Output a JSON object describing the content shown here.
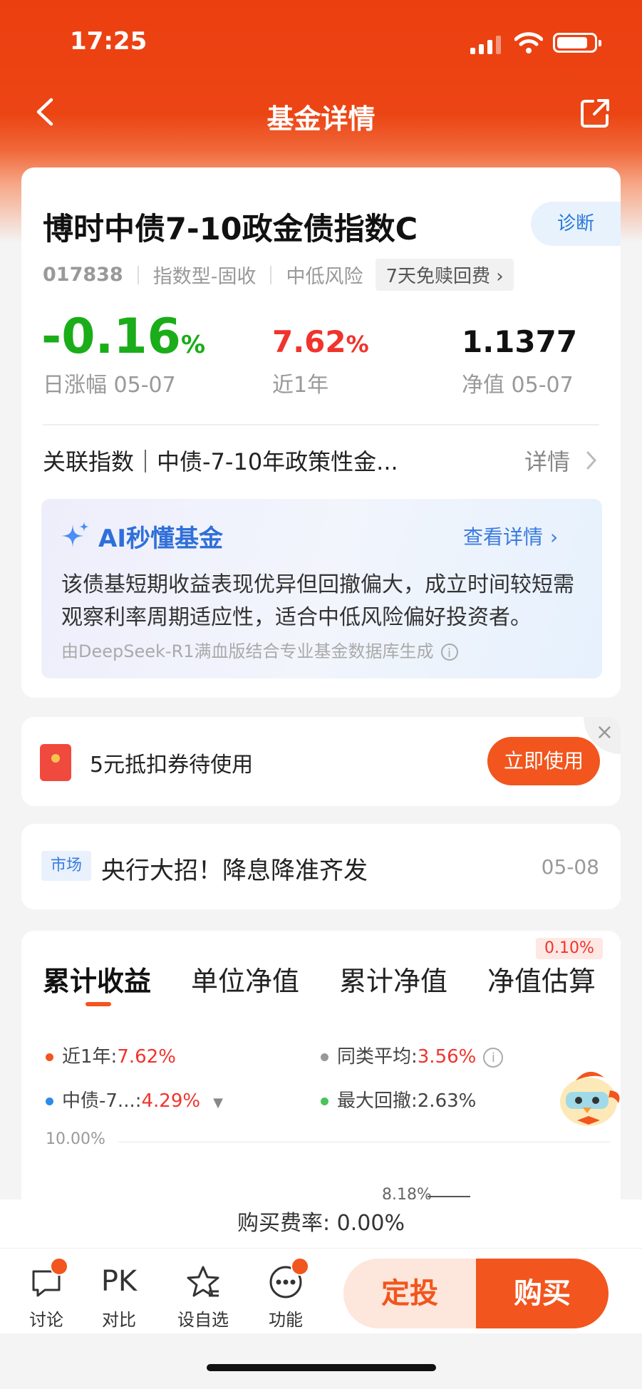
{
  "status_bar": {
    "time": "17:25"
  },
  "nav": {
    "title": "基金详情"
  },
  "fund": {
    "name": "博时中债7-10政金债指数C",
    "diagnose_label": "诊断",
    "code": "017838",
    "type": "指数型-固收",
    "risk": "中低风险",
    "redeem_tag": "7天免赎回费 ›"
  },
  "stats": {
    "daily_change_value": "-0.16",
    "daily_change_unit": "%",
    "daily_change_label": "日涨幅 05-07",
    "year_return_value": "7.62",
    "year_return_unit": "%",
    "year_return_label": "近1年",
    "nav_value": "1.1377",
    "nav_label": "净值 05-07"
  },
  "related_index": {
    "text": "关联指数｜中债-7-10年政策性金...",
    "detail_label": "详情"
  },
  "ai": {
    "title": "AI秒懂基金",
    "more_label": "查看详情",
    "summary": "该债基短期收益表现优异但回撤偏大，成立时间较短需观察利率周期适应性，适合中低风险偏好投资者。",
    "source": "由DeepSeek-R1满血版结合专业基金数据库生成"
  },
  "coupon": {
    "text": "5元抵扣券待使用",
    "button": "立即使用",
    "close": "×"
  },
  "news": {
    "tag": "市场",
    "headline": "央行大招！降息降准齐发",
    "date": "05-08"
  },
  "performance": {
    "tabs": [
      "累计收益",
      "单位净值",
      "累计净值",
      "净值估算"
    ],
    "estimate_badge": "0.10%",
    "legend": {
      "year_label": "近1年:",
      "year_value": "7.62%",
      "peer_label": "同类平均:",
      "peer_value": "3.56%",
      "index_label": "中债-7...:",
      "index_value": "4.29%",
      "drawdown_label": "最大回撤:",
      "drawdown_value": "2.63%"
    },
    "grid_top_label": "10.00%",
    "peek_label": "8.18%"
  },
  "colors": {
    "accent": "#f2551d",
    "up": "#f0342c",
    "down": "#1aad19",
    "ai_blue": "#2f6fd8"
  },
  "footer": {
    "fee_text": "购买费率: 0.00%",
    "tools": [
      {
        "label": "讨论",
        "icon": "chat-icon"
      },
      {
        "label": "对比",
        "icon": "pk-icon",
        "glyph": "PK"
      },
      {
        "label": "设自选",
        "icon": "star-icon"
      },
      {
        "label": "功能",
        "icon": "more-icon"
      }
    ],
    "sip_button": "定投",
    "buy_button": "购买"
  }
}
